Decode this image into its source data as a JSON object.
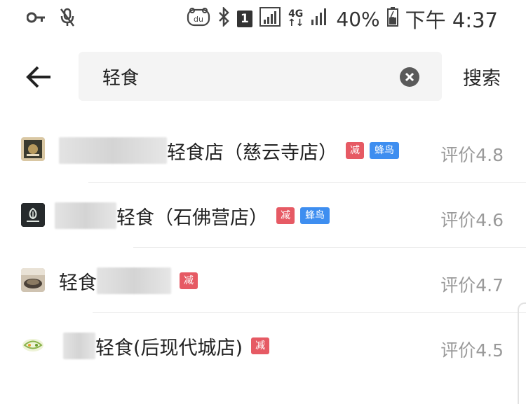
{
  "status_bar": {
    "icons_left": [
      "key-icon",
      "mic-off-icon"
    ],
    "icons_right": [
      "du-icon",
      "bluetooth-icon",
      "sim1-icon",
      "signal-icon",
      "network-4g-icon",
      "signal-icon",
      "battery-icon"
    ],
    "sim_label": "1",
    "network_label": "4G",
    "battery": "40%",
    "time": "下午 4:37"
  },
  "header": {
    "query": "轻食",
    "search_label": "搜索"
  },
  "results": [
    {
      "name": "轻食店（慈云寺店）",
      "tags": [
        "减",
        "蜂鸟"
      ],
      "rating": "评价4.8"
    },
    {
      "name": "轻食（石佛营店）",
      "tags": [
        "减",
        "蜂鸟"
      ],
      "rating": "评价4.6"
    },
    {
      "name": "轻食",
      "tags": [
        "减"
      ],
      "rating": "评价4.7"
    },
    {
      "name": "轻食(后现代城店)",
      "tags": [
        "减"
      ],
      "rating": "评价4.5"
    }
  ],
  "colors": {
    "tag_jian": "#e65a64",
    "tag_fengniao": "#3e8ef0",
    "rating_text": "#9a9a9a",
    "search_bg": "#f4f4f4"
  }
}
